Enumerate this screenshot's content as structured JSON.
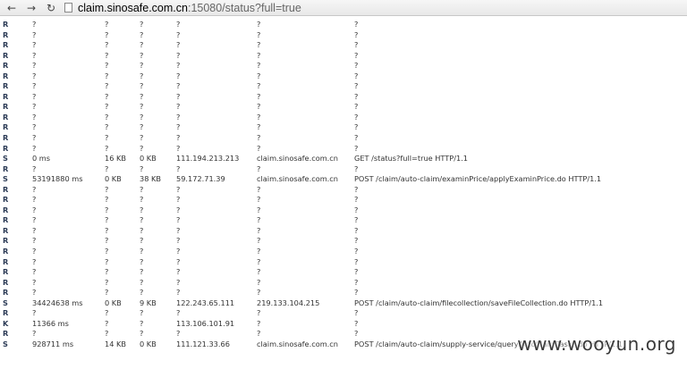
{
  "browser": {
    "back_icon": "←",
    "forward_icon": "→",
    "reload_icon": "↻",
    "url_host": "claim.sinosafe.com.cn",
    "url_rest": ":15080/status?full=true"
  },
  "rows": [
    [
      "R",
      "?",
      "?",
      "?",
      "?",
      "?",
      "?"
    ],
    [
      "R",
      "?",
      "?",
      "?",
      "?",
      "?",
      "?"
    ],
    [
      "R",
      "?",
      "?",
      "?",
      "?",
      "?",
      "?"
    ],
    [
      "R",
      "?",
      "?",
      "?",
      "?",
      "?",
      "?"
    ],
    [
      "R",
      "?",
      "?",
      "?",
      "?",
      "?",
      "?"
    ],
    [
      "R",
      "?",
      "?",
      "?",
      "?",
      "?",
      "?"
    ],
    [
      "R",
      "?",
      "?",
      "?",
      "?",
      "?",
      "?"
    ],
    [
      "R",
      "?",
      "?",
      "?",
      "?",
      "?",
      "?"
    ],
    [
      "R",
      "?",
      "?",
      "?",
      "?",
      "?",
      "?"
    ],
    [
      "R",
      "?",
      "?",
      "?",
      "?",
      "?",
      "?"
    ],
    [
      "R",
      "?",
      "?",
      "?",
      "?",
      "?",
      "?"
    ],
    [
      "R",
      "?",
      "?",
      "?",
      "?",
      "?",
      "?"
    ],
    [
      "R",
      "?",
      "?",
      "?",
      "?",
      "?",
      "?"
    ],
    [
      "S",
      "0 ms",
      "16 KB",
      "0 KB",
      "111.194.213.213",
      "claim.sinosafe.com.cn",
      "GET /status?full=true HTTP/1.1"
    ],
    [
      "R",
      "?",
      "?",
      "?",
      "?",
      "?",
      "?"
    ],
    [
      "S",
      "53191880 ms",
      "0 KB",
      "38 KB",
      "59.172.71.39",
      "claim.sinosafe.com.cn",
      "POST /claim/auto-claim/examinPrice/applyExaminPrice.do HTTP/1.1"
    ],
    [
      "R",
      "?",
      "?",
      "?",
      "?",
      "?",
      "?"
    ],
    [
      "R",
      "?",
      "?",
      "?",
      "?",
      "?",
      "?"
    ],
    [
      "R",
      "?",
      "?",
      "?",
      "?",
      "?",
      "?"
    ],
    [
      "R",
      "?",
      "?",
      "?",
      "?",
      "?",
      "?"
    ],
    [
      "R",
      "?",
      "?",
      "?",
      "?",
      "?",
      "?"
    ],
    [
      "R",
      "?",
      "?",
      "?",
      "?",
      "?",
      "?"
    ],
    [
      "R",
      "?",
      "?",
      "?",
      "?",
      "?",
      "?"
    ],
    [
      "R",
      "?",
      "?",
      "?",
      "?",
      "?",
      "?"
    ],
    [
      "R",
      "?",
      "?",
      "?",
      "?",
      "?",
      "?"
    ],
    [
      "R",
      "?",
      "?",
      "?",
      "?",
      "?",
      "?"
    ],
    [
      "R",
      "?",
      "?",
      "?",
      "?",
      "?",
      "?"
    ],
    [
      "S",
      "34424638 ms",
      "0 KB",
      "9 KB",
      "122.243.65.111",
      "219.133.104.215",
      "POST /claim/auto-claim/filecollection/saveFileCollection.do HTTP/1.1"
    ],
    [
      "R",
      "?",
      "?",
      "?",
      "?",
      "?",
      "?"
    ],
    [
      "K",
      "11366 ms",
      "?",
      "?",
      "113.106.101.91",
      "?",
      "?"
    ],
    [
      "R",
      "?",
      "?",
      "?",
      "?",
      "?",
      "?"
    ],
    [
      "S",
      "928711 ms",
      "14 KB",
      "0 KB",
      "111.121.33.66",
      "claim.sinosafe.com.cn",
      "POST /claim/auto-claim/supply-service/queryAutoClaimTasks.do HTTP/1.1"
    ]
  ],
  "watermark": "www.wooyun.org"
}
